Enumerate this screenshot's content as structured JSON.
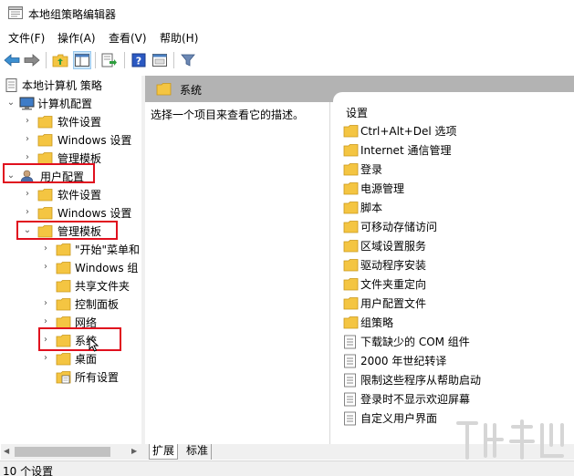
{
  "window": {
    "title": "本地组策略编辑器"
  },
  "menu": {
    "file": "文件(F)",
    "action": "操作(A)",
    "view": "查看(V)",
    "help": "帮助(H)"
  },
  "tree": {
    "root": "本地计算机 策略",
    "computer_config": "计算机配置",
    "computer_children": [
      "软件设置",
      "Windows 设置",
      "管理模板"
    ],
    "user_config": "用户配置",
    "user_children": [
      "软件设置",
      "Windows 设置"
    ],
    "admin_templates": "管理模板",
    "admin_children": [
      "\"开始\"菜单和",
      "Windows 组",
      "共享文件夹",
      "控制面板",
      "网络",
      "系统",
      "桌面",
      "所有设置"
    ]
  },
  "right_pane": {
    "header_title": "系统",
    "description": "选择一个项目来查看它的描述。",
    "list_header": "设置",
    "folders": [
      "Ctrl+Alt+Del 选项",
      "Internet 通信管理",
      "登录",
      "电源管理",
      "脚本",
      "可移动存储访问",
      "区域设置服务",
      "驱动程序安装",
      "文件夹重定向",
      "用户配置文件",
      "组策略"
    ],
    "settings": [
      "下载缺少的 COM 组件",
      "2000 年世纪转译",
      "限制这些程序从帮助启动",
      "登录时不显示欢迎屏幕",
      "自定义用户界面"
    ]
  },
  "tabs": {
    "extended": "扩展",
    "standard": "标准"
  },
  "status": {
    "text": "10 个设置"
  },
  "colors": {
    "highlight": "#e0101e",
    "header_bg": "#b3b3b3",
    "folder": "#f4c542"
  }
}
